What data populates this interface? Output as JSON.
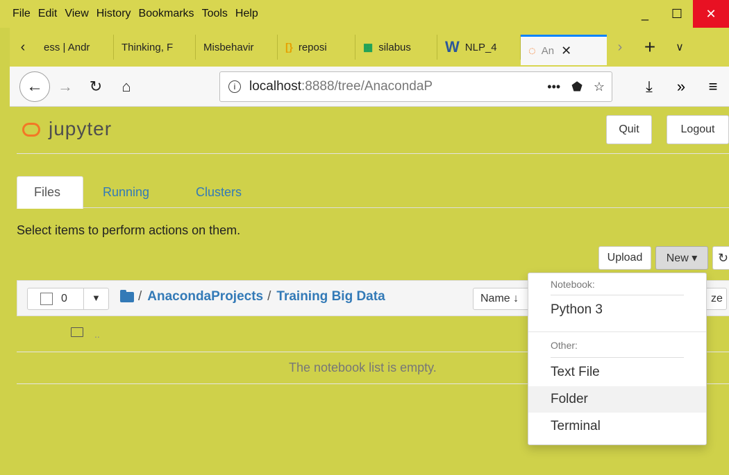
{
  "menubar": {
    "items": [
      "File",
      "Edit",
      "View",
      "History",
      "Bookmarks",
      "Tools",
      "Help"
    ]
  },
  "window_controls": {
    "minimize": "_",
    "maximize": "☐",
    "close": "✕"
  },
  "browser_tabs": [
    {
      "label": "ess | Andr",
      "icon": ""
    },
    {
      "label": "Thinking, F",
      "icon": ""
    },
    {
      "label": "Misbehavir",
      "icon": ""
    },
    {
      "label": "reposi",
      "icon": "[}"
    },
    {
      "label": "silabus",
      "icon": "▦"
    },
    {
      "label": "NLP_4",
      "icon": "W"
    },
    {
      "label": "An",
      "icon": "jupyter-icon",
      "active": true
    }
  ],
  "urlbar": {
    "host": "localhost",
    "rest": ":8888/tree/AnacondaP",
    "more": "•••"
  },
  "jupyter": {
    "logo_text": "jupyter",
    "quit_label": "Quit",
    "logout_label": "Logout",
    "tabs": [
      "Files",
      "Running",
      "Clusters"
    ],
    "select_msg": "Select items to perform actions on them.",
    "upload_label": "Upload",
    "new_label": "New ▾",
    "selected_count": "0",
    "breadcrumb": [
      "AnacondaProjects",
      "Training Big Data"
    ],
    "name_sort_label": "Name ↓",
    "size_sort_label": "ze",
    "parent_dir": "..",
    "empty_msg": "The notebook list is empty."
  },
  "new_menu": {
    "notebook_header": "Notebook:",
    "notebook_items": [
      "Python 3"
    ],
    "other_header": "Other:",
    "other_items": [
      "Text File",
      "Folder",
      "Terminal"
    ],
    "hovered": "Folder"
  },
  "colors": {
    "accent": "#337ab7",
    "jupyter_orange": "#f37726",
    "window_frame": "#d8d650",
    "close_red": "#e81123"
  }
}
